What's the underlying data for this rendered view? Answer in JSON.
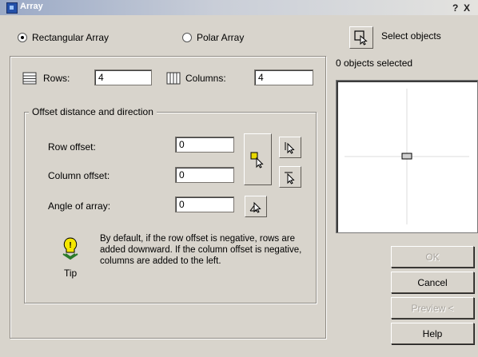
{
  "window": {
    "title": "Array",
    "help_glyph": "?",
    "close_glyph": "X"
  },
  "mode": {
    "rectangular_label": "Rectangular Array",
    "polar_label": "Polar Array",
    "selected": "rectangular"
  },
  "selection": {
    "select_objects_label": "Select objects",
    "status": "0 objects selected"
  },
  "grid": {
    "rows_label": "Rows:",
    "rows_value": "4",
    "columns_label": "Columns:",
    "columns_value": "4"
  },
  "offset": {
    "group_title": "Offset distance and direction",
    "row_offset_label": "Row offset:",
    "row_offset_value": "0",
    "column_offset_label": "Column offset:",
    "column_offset_value": "0",
    "angle_label": "Angle of array:",
    "angle_value": "0"
  },
  "tip": {
    "label": "Tip",
    "text": "By default, if the row offset is negative, rows are added downward. If the column offset is negative, columns are added to the left."
  },
  "buttons": {
    "ok": "OK",
    "cancel": "Cancel",
    "preview": "Preview <",
    "help": "Help"
  },
  "icons": {
    "rows": "rows-icon",
    "columns": "columns-icon",
    "pick": "pick-cursor-icon",
    "select": "select-objects-icon",
    "tip": "lightbulb-icon"
  }
}
